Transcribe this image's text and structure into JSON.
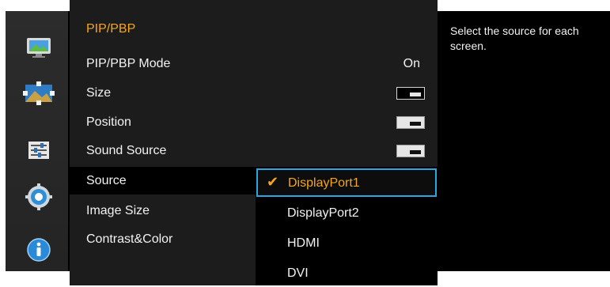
{
  "menu": {
    "title": "PIP/PBP",
    "rows": [
      {
        "label": "PIP/PBP Mode",
        "value": "On"
      },
      {
        "label": "Size"
      },
      {
        "label": "Position"
      },
      {
        "label": "Sound Source"
      },
      {
        "label": "Source"
      },
      {
        "label": "Image Size"
      },
      {
        "label": "Contrast&Color"
      }
    ]
  },
  "source_dropdown": {
    "selected": "DisplayPort1",
    "options": [
      "DisplayPort1",
      "DisplayPort2",
      "HDMI",
      "DVI"
    ]
  },
  "help": {
    "text": "Select the source for each screen."
  },
  "sidebar": {
    "icons": [
      "picture-icon",
      "onscreen-display-icon",
      "settings-sliders-icon",
      "system-gear-icon",
      "information-icon"
    ]
  },
  "colors": {
    "accent": "#f7a51b",
    "focus": "#2aa7e0"
  }
}
